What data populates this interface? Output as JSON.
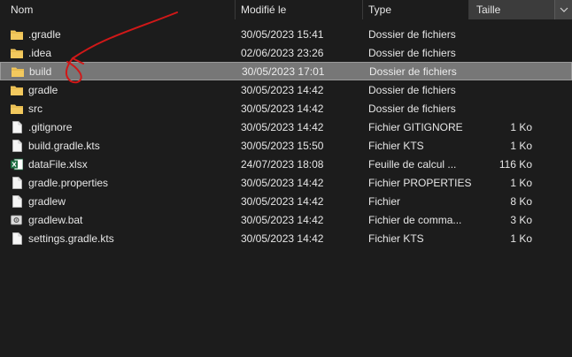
{
  "columns": {
    "name": "Nom",
    "date": "Modifié le",
    "type": "Type",
    "size": "Taille"
  },
  "files": [
    {
      "name": ".gradle",
      "date": "30/05/2023 15:41",
      "type": "Dossier de fichiers",
      "size": "",
      "icon": "folder-icon"
    },
    {
      "name": ".idea",
      "date": "02/06/2023 23:26",
      "type": "Dossier de fichiers",
      "size": "",
      "icon": "folder-icon"
    },
    {
      "name": "build",
      "date": "30/05/2023 17:01",
      "type": "Dossier de fichiers",
      "size": "",
      "icon": "folder-icon"
    },
    {
      "name": "gradle",
      "date": "30/05/2023 14:42",
      "type": "Dossier de fichiers",
      "size": "",
      "icon": "folder-icon"
    },
    {
      "name": "src",
      "date": "30/05/2023 14:42",
      "type": "Dossier de fichiers",
      "size": "",
      "icon": "folder-icon"
    },
    {
      "name": ".gitignore",
      "date": "30/05/2023 14:42",
      "type": "Fichier GITIGNORE",
      "size": "1 Ko",
      "icon": "file-icon"
    },
    {
      "name": "build.gradle.kts",
      "date": "30/05/2023 15:50",
      "type": "Fichier KTS",
      "size": "1 Ko",
      "icon": "file-icon"
    },
    {
      "name": "dataFile.xlsx",
      "date": "24/07/2023 18:08",
      "type": "Feuille de calcul ...",
      "size": "116 Ko",
      "icon": "excel-icon"
    },
    {
      "name": "gradle.properties",
      "date": "30/05/2023 14:42",
      "type": "Fichier PROPERTIES",
      "size": "1 Ko",
      "icon": "file-icon"
    },
    {
      "name": "gradlew",
      "date": "30/05/2023 14:42",
      "type": "Fichier",
      "size": "8 Ko",
      "icon": "file-icon"
    },
    {
      "name": "gradlew.bat",
      "date": "30/05/2023 14:42",
      "type": "Fichier de comma...",
      "size": "3 Ko",
      "icon": "batch-file-icon"
    },
    {
      "name": "settings.gradle.kts",
      "date": "30/05/2023 14:42",
      "type": "Fichier KTS",
      "size": "1 Ko",
      "icon": "file-icon"
    }
  ],
  "selected_index": 2,
  "colors": {
    "background": "#1c1c1c",
    "selection": "#777777",
    "folder": "#f3c95e",
    "annotation": "#d01818"
  }
}
